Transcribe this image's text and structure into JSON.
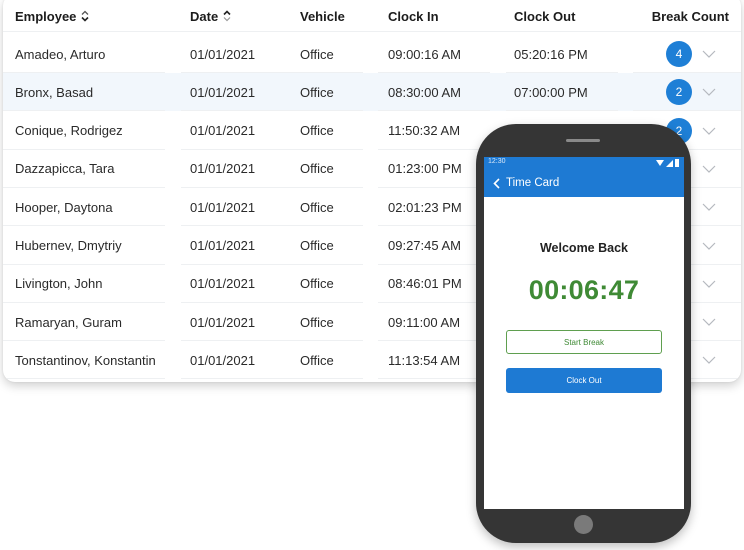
{
  "table": {
    "columns": {
      "employee": "Employee",
      "date": "Date",
      "vehicle": "Vehicle",
      "clock_in": "Clock In",
      "clock_out": "Clock Out",
      "break_count": "Break Count"
    },
    "rows": [
      {
        "employee": "Amadeo, Arturo",
        "date": "01/01/2021",
        "vehicle": "Office",
        "clock_in": "09:00:16 AM",
        "clock_out": "05:20:16 PM",
        "break_count": "4"
      },
      {
        "employee": "Bronx, Basad",
        "date": "01/01/2021",
        "vehicle": "Office",
        "clock_in": "08:30:00 AM",
        "clock_out": "07:00:00 PM",
        "break_count": "2"
      },
      {
        "employee": "Conique, Rodrigez",
        "date": "01/01/2021",
        "vehicle": "Office",
        "clock_in": "11:50:32 AM",
        "clock_out": "",
        "break_count": "2"
      },
      {
        "employee": "Dazzapicca, Tara",
        "date": "01/01/2021",
        "vehicle": "Office",
        "clock_in": "01:23:00 PM",
        "clock_out": "",
        "break_count": ""
      },
      {
        "employee": "Hooper, Daytona",
        "date": "01/01/2021",
        "vehicle": "Office",
        "clock_in": "02:01:23 PM",
        "clock_out": "",
        "break_count": ""
      },
      {
        "employee": "Hubernev, Dmytriy",
        "date": "01/01/2021",
        "vehicle": "Office",
        "clock_in": "09:27:45 AM",
        "clock_out": "",
        "break_count": ""
      },
      {
        "employee": "Livington, John",
        "date": "01/01/2021",
        "vehicle": "Office",
        "clock_in": "08:46:01 PM",
        "clock_out": "",
        "break_count": ""
      },
      {
        "employee": "Ramaryan, Guram",
        "date": "01/01/2021",
        "vehicle": "Office",
        "clock_in": "09:11:00 AM",
        "clock_out": "",
        "break_count": ""
      },
      {
        "employee": "Tonstantinov, Konstantin",
        "date": "01/01/2021",
        "vehicle": "Office",
        "clock_in": "11:13:54 AM",
        "clock_out": "",
        "break_count": ""
      }
    ],
    "highlighted_row": 1
  },
  "phone": {
    "status_time": "12:30",
    "app_title": "Time Card",
    "welcome": "Welcome Back",
    "timer": "00:06:47",
    "start_break_label": "Start Break",
    "clock_out_label": "Clock Out"
  },
  "colors": {
    "accent_blue": "#1e7ad3",
    "timer_green": "#3f8a35",
    "badge_blue": "#1e7fd6",
    "row_highlight": "#f2f7fc"
  }
}
